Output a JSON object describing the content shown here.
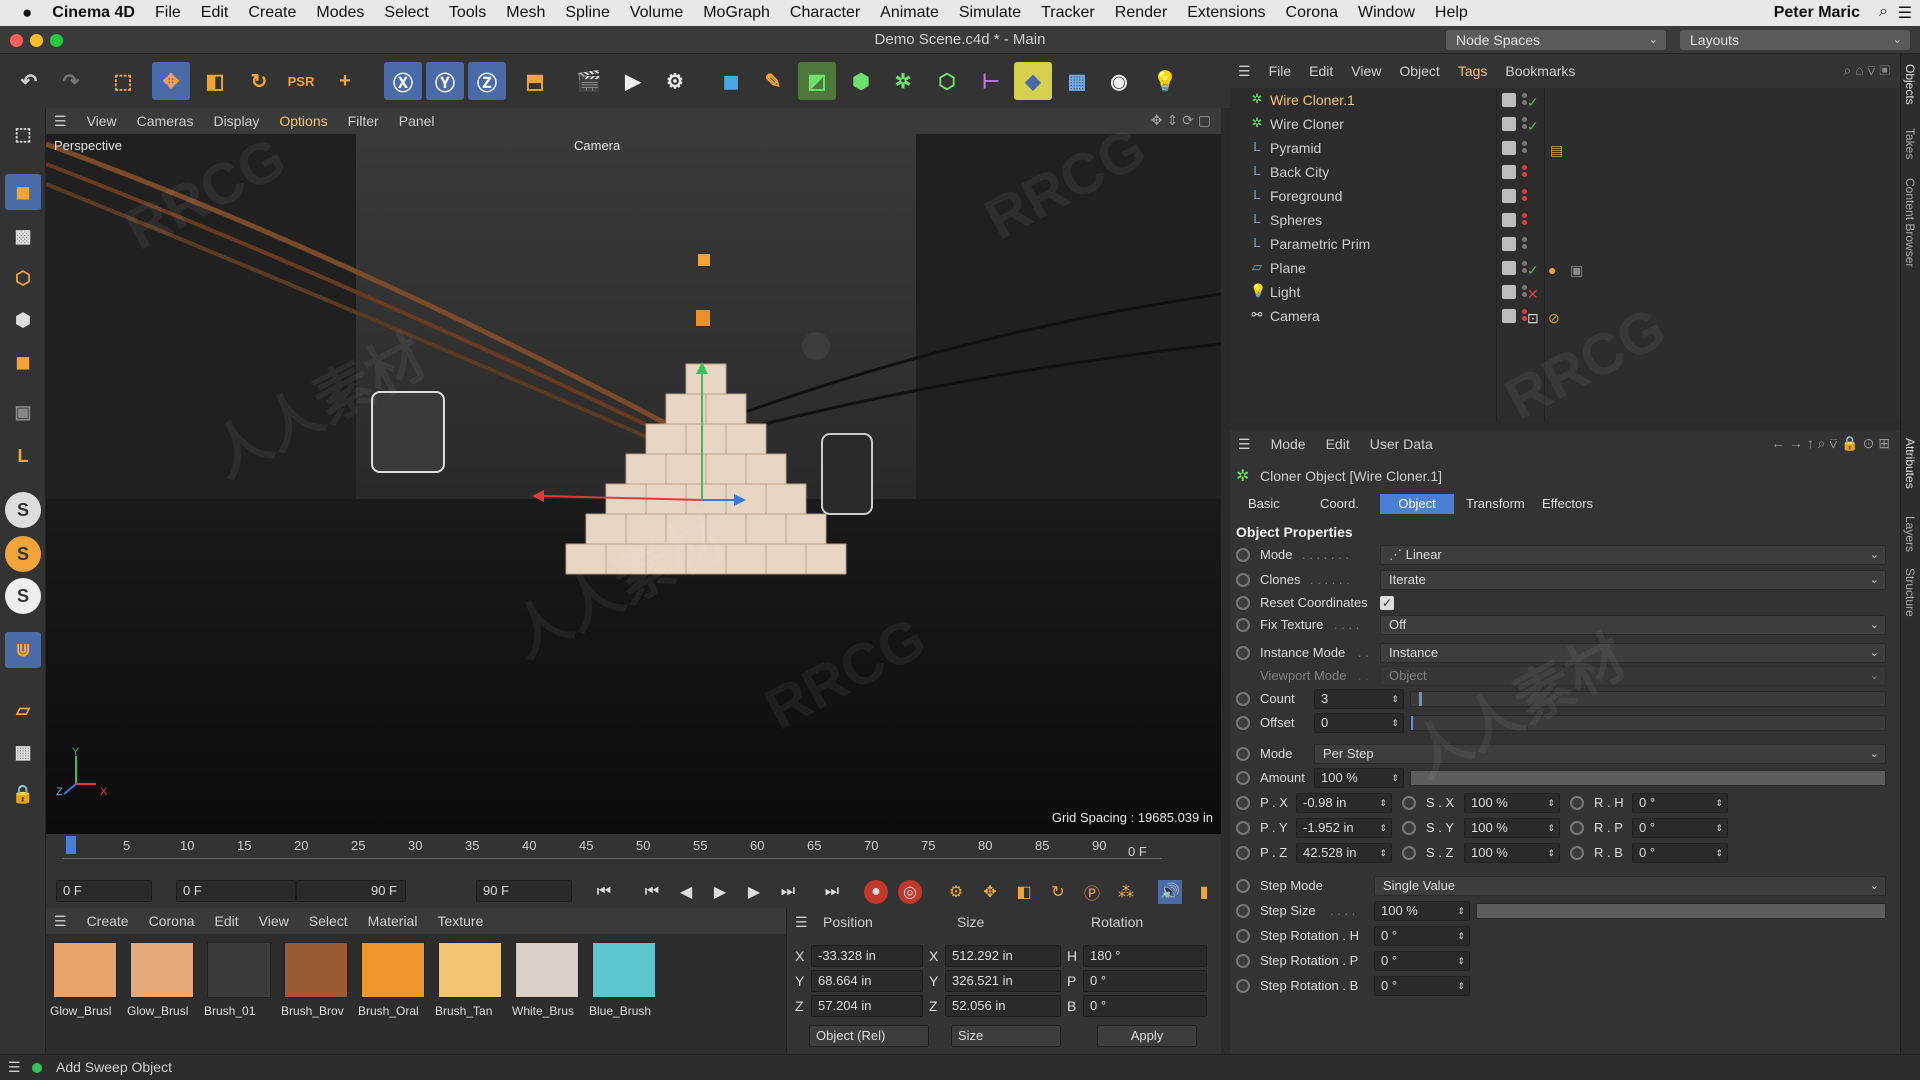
{
  "mac_menu": {
    "apple": "",
    "app": "Cinema 4D",
    "items": [
      "File",
      "Edit",
      "Create",
      "Modes",
      "Select",
      "Tools",
      "Mesh",
      "Spline",
      "Volume",
      "MoGraph",
      "Character",
      "Animate",
      "Simulate",
      "Tracker",
      "Render",
      "Extensions",
      "Corona",
      "Window",
      "Help"
    ],
    "user": "Peter Maric"
  },
  "window": {
    "title": "Demo Scene.c4d * - Main",
    "node_spaces": "Node Spaces",
    "layouts": "Layouts"
  },
  "viewport_menu": [
    "View",
    "Cameras",
    "Display",
    "Options",
    "Filter",
    "Panel"
  ],
  "viewport": {
    "view_name": "Perspective",
    "camera_label": "Camera",
    "grid_spacing": "Grid Spacing : 19685.039 in",
    "axis_y": "Y",
    "axis_z": "Z",
    "axis_x": "X"
  },
  "timeline": {
    "ticks": [
      "0",
      "5",
      "10",
      "15",
      "20",
      "25",
      "30",
      "35",
      "40",
      "45",
      "50",
      "55",
      "60",
      "65",
      "70",
      "75",
      "80",
      "85",
      "90"
    ],
    "current_frame": "0 F"
  },
  "transport": {
    "start": "0 F",
    "range_start": "0 F",
    "range_end": "90 F",
    "end": "90 F"
  },
  "material_menu": [
    "Create",
    "Corona",
    "Edit",
    "View",
    "Select",
    "Material",
    "Texture"
  ],
  "materials": [
    {
      "name": "Glow_Brusl",
      "color": "#e8a46a"
    },
    {
      "name": "Glow_Brusl",
      "color": "#e3a978"
    },
    {
      "name": "Brush_01",
      "color": "#3c3a38"
    },
    {
      "name": "Brush_Brov",
      "color": "#9a5a36"
    },
    {
      "name": "Brush_Oral",
      "color": "#f0962e"
    },
    {
      "name": "Brush_Tan",
      "color": "#f2c574"
    },
    {
      "name": "White_Brus",
      "color": "#d9cfc5"
    },
    {
      "name": "Blue_Brush",
      "color": "#5ec6cf"
    }
  ],
  "coords": {
    "headers": {
      "position": "Position",
      "size": "Size",
      "rotation": "Rotation"
    },
    "rows": [
      {
        "axis": "X",
        "pos": "-33.328 in",
        "saxis": "X",
        "size": "512.292 in",
        "raxis": "H",
        "rot": "180 °"
      },
      {
        "axis": "Y",
        "pos": "68.664 in",
        "saxis": "Y",
        "size": "326.521 in",
        "raxis": "P",
        "rot": "0 °"
      },
      {
        "axis": "Z",
        "pos": "57.204 in",
        "saxis": "Z",
        "size": "52.056 in",
        "raxis": "B",
        "rot": "0 °"
      }
    ],
    "mode": "Object (Rel)",
    "size_mode": "Size",
    "apply": "Apply"
  },
  "status": "Add Sweep Object",
  "object_menu": [
    "File",
    "Edit",
    "View",
    "Object",
    "Tags",
    "Bookmarks"
  ],
  "objects": [
    {
      "name": "Wire Cloner.1",
      "icon": "cloner-icon",
      "selected": true,
      "check": "green"
    },
    {
      "name": "Wire Cloner",
      "icon": "cloner-icon",
      "selected": false,
      "check": "green"
    },
    {
      "name": "Pyramid",
      "icon": "null-icon",
      "selected": false,
      "check": "none"
    },
    {
      "name": "Back City",
      "icon": "null-icon",
      "selected": false,
      "check": "none"
    },
    {
      "name": "Foreground",
      "icon": "null-icon",
      "selected": false,
      "check": "none"
    },
    {
      "name": "Spheres",
      "icon": "null-icon",
      "selected": false,
      "check": "none"
    },
    {
      "name": "Parametric Prim",
      "icon": "null-icon",
      "selected": false,
      "check": "none"
    },
    {
      "name": "Plane",
      "icon": "plane-icon",
      "selected": false,
      "check": "green"
    },
    {
      "name": "Light",
      "icon": "light-icon",
      "selected": false,
      "check": "red"
    },
    {
      "name": "Camera",
      "icon": "camera-icon",
      "selected": false,
      "check": "none"
    }
  ],
  "attr_menu": [
    "Mode",
    "Edit",
    "User Data"
  ],
  "attr": {
    "object_title": "Cloner Object [Wire Cloner.1]",
    "tabs": [
      "Basic",
      "Coord.",
      "Object",
      "Transform",
      "Effectors"
    ],
    "active_tab": "Object",
    "section": "Object Properties",
    "mode_label": "Mode",
    "mode_value": "Linear",
    "clones_label": "Clones",
    "clones_value": "Iterate",
    "reset_label": "Reset Coordinates",
    "fix_label": "Fix Texture",
    "fix_value": "Off",
    "instance_label": "Instance Mode",
    "instance_value": "Instance",
    "viewport_label": "Viewport Mode",
    "viewport_value": "Object",
    "count_label": "Count",
    "count_value": "3",
    "offset_label": "Offset",
    "offset_value": "0",
    "mode2_label": "Mode",
    "mode2_value": "Per Step",
    "amount_label": "Amount",
    "amount_value": "100 %",
    "px_label": "P . X",
    "px": "-0.98 in",
    "sx_label": "S . X",
    "sx": "100 %",
    "rh_label": "R . H",
    "rh": "0 °",
    "py_label": "P . Y",
    "py": "-1.952 in",
    "sy_label": "S . Y",
    "sy": "100 %",
    "rp_label": "R . P",
    "rp": "0 °",
    "pz_label": "P . Z",
    "pz": "42.528 in",
    "sz_label": "S . Z",
    "sz": "100 %",
    "rb_label": "R . B",
    "rb": "0 °",
    "stepmode_label": "Step Mode",
    "stepmode_value": "Single Value",
    "stepsize_label": "Step Size",
    "stepsize_value": "100 %",
    "srh_label": "Step Rotation . H",
    "srh": "0 °",
    "srp_label": "Step Rotation . P",
    "srp": "0 °",
    "srb_label": "Step Rotation . B",
    "srb": "0 °"
  },
  "right_tabs": [
    "Objects",
    "Takes",
    "Content Browser",
    "Attributes",
    "Layers",
    "Structure"
  ],
  "watermarks": [
    "RRCG",
    "人人素材"
  ]
}
